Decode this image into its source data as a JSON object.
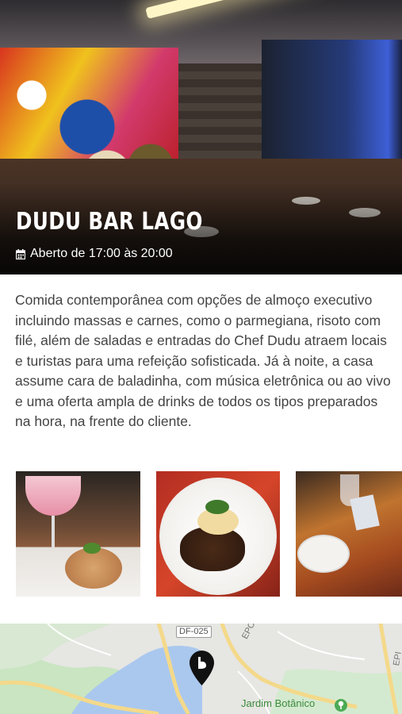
{
  "hero": {
    "title": "DUDU BAR LAGO",
    "hours": "Aberto de 17:00 às 20:00",
    "calendar_icon": "calendar-icon"
  },
  "description": "Comida contemporânea com opções de almoço executivo incluindo massas e carnes, como o parmegiana, risoto com filé, além de saladas e entradas do Chef Dudu atraem locais e turistas para uma refeição sofisticada. Já à noite, a casa assume cara de baladinha, com música eletrônica ou ao vivo e uma oferta ampla de drinks de todos os tipos preparados na hora, na frente do cliente.",
  "gallery": {
    "photos": [
      "drink-and-rice-photo",
      "meat-and-puree-photo",
      "table-setting-photo"
    ]
  },
  "map": {
    "road_label": "DF-025",
    "road_label_2": "EPCV",
    "place_label": "Jardim Botânico",
    "edge_label": "EPI",
    "pin_icon": "map-pin-icon",
    "park_icon": "park-icon"
  },
  "colors": {
    "text": "#444444",
    "title": "#ffffff",
    "map_road": "#f4d98a",
    "map_water": "#aac8ee",
    "map_green": "#c9e5c1"
  }
}
